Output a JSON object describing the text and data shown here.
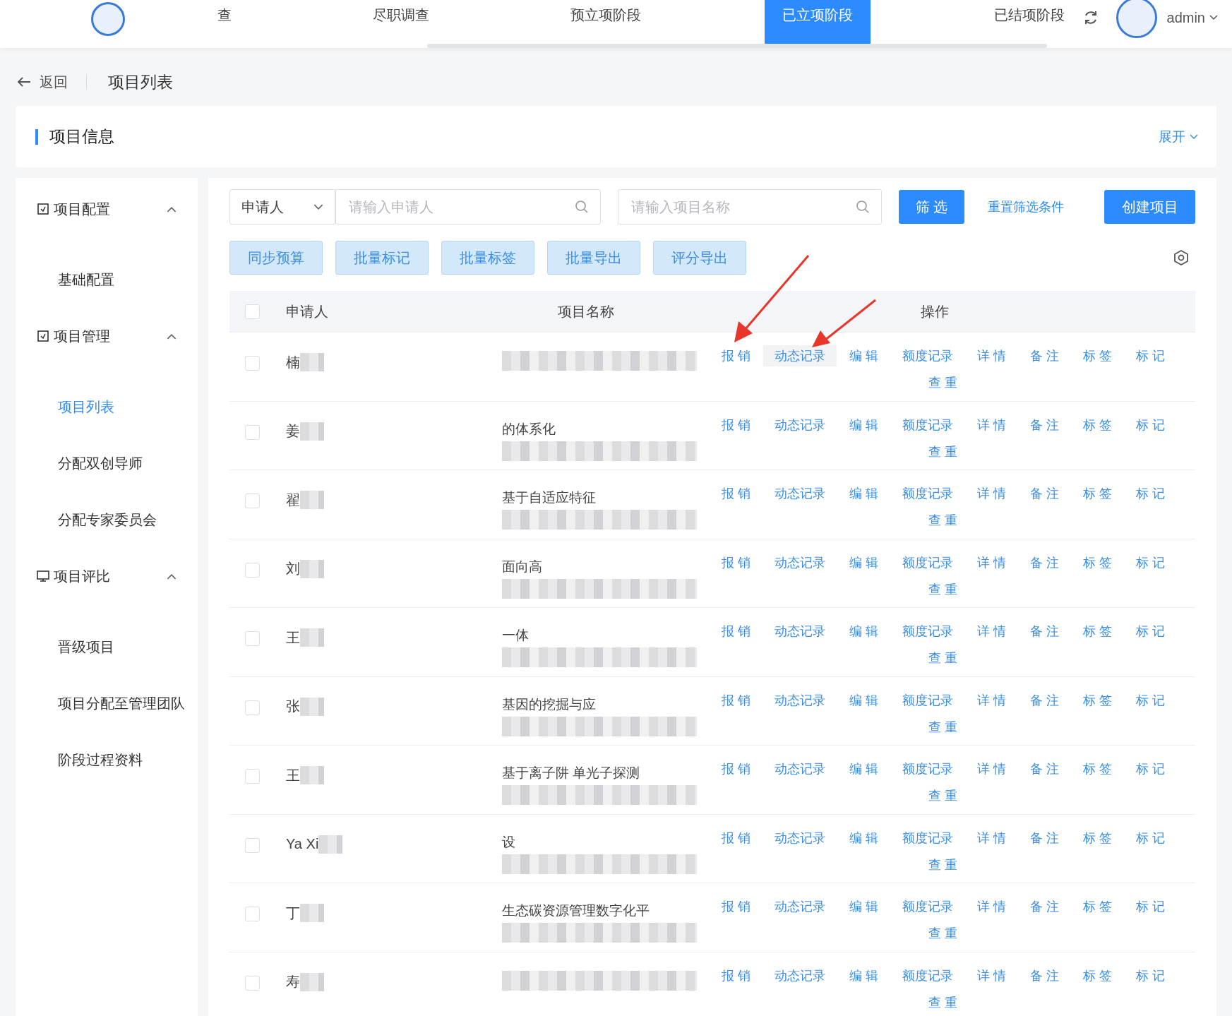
{
  "nav": {
    "tabs": [
      {
        "label": "查",
        "selected": false
      },
      {
        "label": "尽职调查",
        "selected": false
      },
      {
        "label": "预立项阶段",
        "selected": false
      },
      {
        "label": "已立项阶段",
        "selected": true
      },
      {
        "label": "已结项阶段",
        "selected": false
      }
    ],
    "user": {
      "name": "admin"
    }
  },
  "breadcrumb": {
    "back": "返回",
    "title": "项目列表"
  },
  "info_card": {
    "title": "项目信息",
    "toggle": "展开"
  },
  "sidebar": {
    "groups": [
      {
        "label": "项目配置",
        "expanded": true,
        "children": [
          {
            "label": "基础配置",
            "selected": false
          }
        ]
      },
      {
        "label": "项目管理",
        "expanded": true,
        "children": [
          {
            "label": "项目列表",
            "selected": true
          },
          {
            "label": "分配双创导师",
            "selected": false
          },
          {
            "label": "分配专家委员会",
            "selected": false
          }
        ]
      },
      {
        "label": "项目评比",
        "expanded": true,
        "children": [
          {
            "label": "晋级项目",
            "selected": false
          },
          {
            "label": "项目分配至管理团队",
            "selected": false
          },
          {
            "label": "阶段过程资料",
            "selected": false
          }
        ]
      }
    ]
  },
  "filters": {
    "field_select": "申请人",
    "applicant_search": {
      "placeholder": "请输入申请人"
    },
    "project_search": {
      "placeholder": "请输入项目名称"
    },
    "filter_button": "筛 选",
    "reset_link": "重置筛选条件",
    "create_button": "创建项目"
  },
  "bulk_buttons": [
    "同步预算",
    "批量标记",
    "批量标签",
    "批量导出",
    "评分导出"
  ],
  "table": {
    "columns": [
      "申请人",
      "项目名称",
      "操作"
    ],
    "header_checked": false,
    "rows": [
      {
        "checked": false,
        "applicant": "楠",
        "actions": [
          {
            "label": "报 销",
            "hovered": false
          },
          {
            "label": "动态记录",
            "hovered": true
          },
          {
            "label": "编 辑",
            "hovered": false
          },
          {
            "label": "额度记录",
            "hovered": false
          },
          {
            "label": "详 情",
            "hovered": false
          },
          {
            "label": "备 注",
            "hovered": false
          },
          {
            "label": "标 签",
            "hovered": false
          },
          {
            "label": "标 记",
            "hovered": false
          },
          {
            "label": "查 重",
            "hovered": false
          }
        ]
      },
      {
        "checked": false,
        "applicant": "姜",
        "project": "的体系化",
        "actions": [
          {
            "label": "报 销",
            "hovered": false
          },
          {
            "label": "动态记录",
            "hovered": false
          },
          {
            "label": "编 辑",
            "hovered": false
          },
          {
            "label": "额度记录",
            "hovered": false
          },
          {
            "label": "详 情",
            "hovered": false
          },
          {
            "label": "备 注",
            "hovered": false
          },
          {
            "label": "标 签",
            "hovered": false
          },
          {
            "label": "标 记",
            "hovered": false
          },
          {
            "label": "查 重",
            "hovered": false
          }
        ]
      },
      {
        "checked": false,
        "applicant": "翟",
        "project": "基于自适应特征",
        "actions": [
          {
            "label": "报 销",
            "hovered": false
          },
          {
            "label": "动态记录",
            "hovered": false
          },
          {
            "label": "编 辑",
            "hovered": false
          },
          {
            "label": "额度记录",
            "hovered": false
          },
          {
            "label": "详 情",
            "hovered": false
          },
          {
            "label": "备 注",
            "hovered": false
          },
          {
            "label": "标 签",
            "hovered": false
          },
          {
            "label": "标 记",
            "hovered": false
          },
          {
            "label": "查 重",
            "hovered": false
          }
        ]
      },
      {
        "checked": false,
        "applicant": "刘",
        "project": "面向高",
        "actions": [
          {
            "label": "报 销",
            "hovered": false
          },
          {
            "label": "动态记录",
            "hovered": false
          },
          {
            "label": "编 辑",
            "hovered": false
          },
          {
            "label": "额度记录",
            "hovered": false
          },
          {
            "label": "详 情",
            "hovered": false
          },
          {
            "label": "备 注",
            "hovered": false
          },
          {
            "label": "标 签",
            "hovered": false
          },
          {
            "label": "标 记",
            "hovered": false
          },
          {
            "label": "查 重",
            "hovered": false
          }
        ]
      },
      {
        "checked": false,
        "applicant": "王",
        "project": "一体",
        "actions": [
          {
            "label": "报 销",
            "hovered": false
          },
          {
            "label": "动态记录",
            "hovered": false
          },
          {
            "label": "编 辑",
            "hovered": false
          },
          {
            "label": "额度记录",
            "hovered": false
          },
          {
            "label": "详 情",
            "hovered": false
          },
          {
            "label": "备 注",
            "hovered": false
          },
          {
            "label": "标 签",
            "hovered": false
          },
          {
            "label": "标 记",
            "hovered": false
          },
          {
            "label": "查 重",
            "hovered": false
          }
        ]
      },
      {
        "checked": false,
        "applicant": "张",
        "project": "基因的挖掘与应",
        "actions": [
          {
            "label": "报 销",
            "hovered": false
          },
          {
            "label": "动态记录",
            "hovered": false
          },
          {
            "label": "编 辑",
            "hovered": false
          },
          {
            "label": "额度记录",
            "hovered": false
          },
          {
            "label": "详 情",
            "hovered": false
          },
          {
            "label": "备 注",
            "hovered": false
          },
          {
            "label": "标 签",
            "hovered": false
          },
          {
            "label": "标 记",
            "hovered": false
          },
          {
            "label": "查 重",
            "hovered": false
          }
        ]
      },
      {
        "checked": false,
        "applicant": "王",
        "project": "基于离子阱 单光子探测",
        "actions": [
          {
            "label": "报 销",
            "hovered": false
          },
          {
            "label": "动态记录",
            "hovered": false
          },
          {
            "label": "编 辑",
            "hovered": false
          },
          {
            "label": "额度记录",
            "hovered": false
          },
          {
            "label": "详 情",
            "hovered": false
          },
          {
            "label": "备 注",
            "hovered": false
          },
          {
            "label": "标 签",
            "hovered": false
          },
          {
            "label": "标 记",
            "hovered": false
          },
          {
            "label": "查 重",
            "hovered": false
          }
        ]
      },
      {
        "checked": false,
        "applicant": "Ya Xi",
        "project": "设",
        "actions": [
          {
            "label": "报 销",
            "hovered": false
          },
          {
            "label": "动态记录",
            "hovered": false
          },
          {
            "label": "编 辑",
            "hovered": false
          },
          {
            "label": "额度记录",
            "hovered": false
          },
          {
            "label": "详 情",
            "hovered": false
          },
          {
            "label": "备 注",
            "hovered": false
          },
          {
            "label": "标 签",
            "hovered": false
          },
          {
            "label": "标 记",
            "hovered": false
          },
          {
            "label": "查 重",
            "hovered": false
          }
        ]
      },
      {
        "checked": false,
        "applicant": "丁",
        "project": "生态碳资源管理数字化平",
        "actions": [
          {
            "label": "报 销",
            "hovered": false
          },
          {
            "label": "动态记录",
            "hovered": false
          },
          {
            "label": "编 辑",
            "hovered": false
          },
          {
            "label": "额度记录",
            "hovered": false
          },
          {
            "label": "详 情",
            "hovered": false
          },
          {
            "label": "备 注",
            "hovered": false
          },
          {
            "label": "标 签",
            "hovered": false
          },
          {
            "label": "标 记",
            "hovered": false
          },
          {
            "label": "查 重",
            "hovered": false
          }
        ]
      },
      {
        "checked": false,
        "applicant": "寿",
        "actions": [
          {
            "label": "报 销",
            "hovered": false
          },
          {
            "label": "动态记录",
            "hovered": false
          },
          {
            "label": "编 辑",
            "hovered": false
          },
          {
            "label": "额度记录",
            "hovered": false
          },
          {
            "label": "详 情",
            "hovered": false
          },
          {
            "label": "备 注",
            "hovered": false
          },
          {
            "label": "标 签",
            "hovered": false
          },
          {
            "label": "标 记",
            "hovered": false
          },
          {
            "label": "查 重",
            "hovered": false
          }
        ]
      }
    ]
  }
}
